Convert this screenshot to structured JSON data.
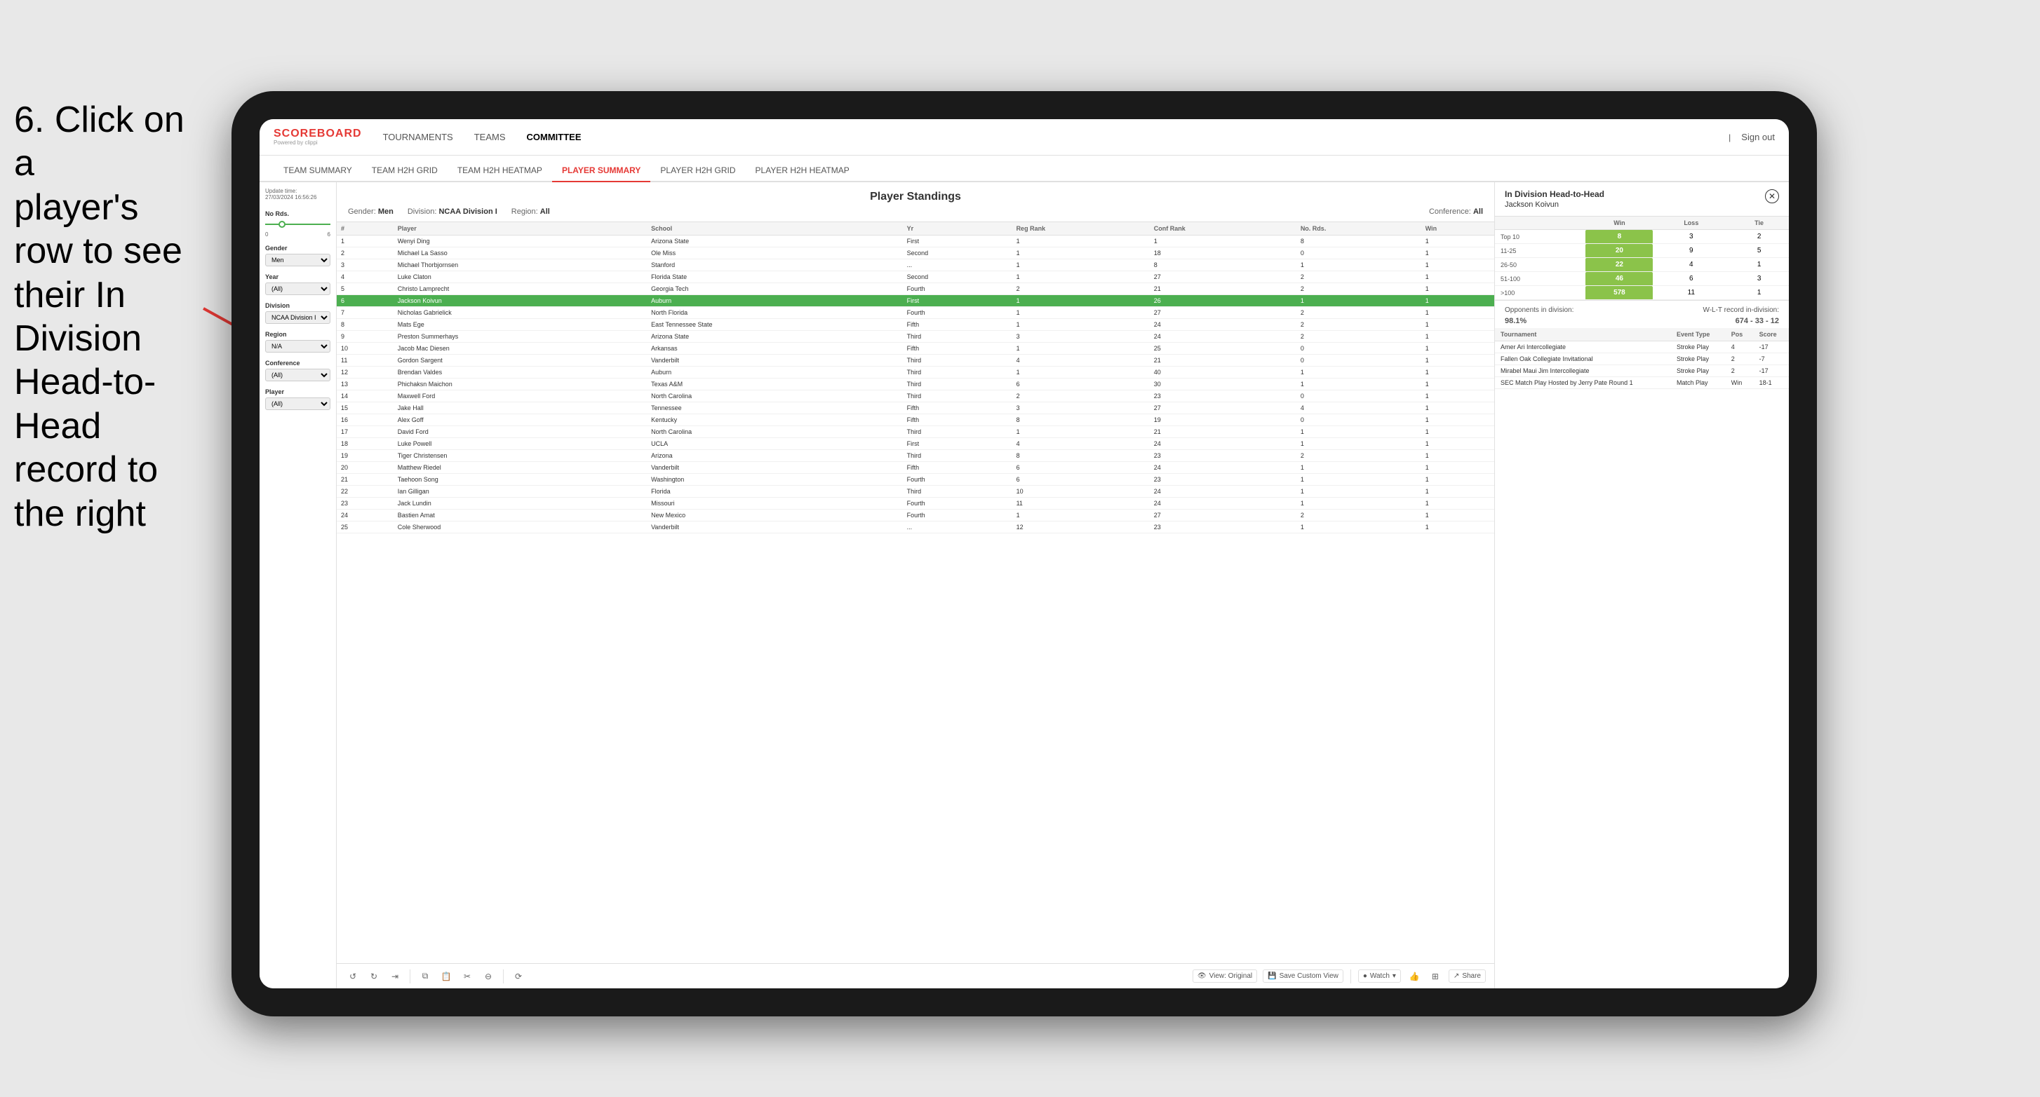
{
  "instruction": {
    "line1": "6. Click on a",
    "line2": "player's row to see",
    "line3": "their In Division",
    "line4": "Head-to-Head",
    "line5": "record to the right"
  },
  "nav": {
    "logo": "SCOREBOARD",
    "logo_sub": "Powered by clippi",
    "items": [
      "TOURNAMENTS",
      "TEAMS",
      "COMMITTEE"
    ],
    "sign_out": "Sign out"
  },
  "sub_nav": {
    "items": [
      "TEAM SUMMARY",
      "TEAM H2H GRID",
      "TEAM H2H HEATMAP",
      "PLAYER SUMMARY",
      "PLAYER H2H GRID",
      "PLAYER H2H HEATMAP"
    ],
    "active": "PLAYER SUMMARY"
  },
  "update_time": {
    "label": "Update time:",
    "value": "27/03/2024 16:56:26"
  },
  "standings": {
    "title": "Player Standings",
    "gender_label": "Gender:",
    "gender": "Men",
    "division_label": "Division:",
    "division": "NCAA Division I",
    "region_label": "Region:",
    "region": "All",
    "conference_label": "Conference:",
    "conference": "All",
    "columns": [
      "#",
      "Player",
      "School",
      "Yr",
      "Reg Rank",
      "Conf Rank",
      "No. Rds.",
      "Win"
    ],
    "rows": [
      {
        "rank": "1",
        "player": "Wenyi Ding",
        "school": "Arizona State",
        "year": "First",
        "reg_rank": "1",
        "conf_rank": "1",
        "no_rds": "8",
        "win": "1"
      },
      {
        "rank": "2",
        "player": "Michael La Sasso",
        "school": "Ole Miss",
        "year": "Second",
        "reg_rank": "1",
        "conf_rank": "18",
        "no_rds": "0",
        "win": "1"
      },
      {
        "rank": "3",
        "player": "Michael Thorbjornsen",
        "school": "Stanford",
        "year": "...",
        "reg_rank": "1",
        "conf_rank": "8",
        "no_rds": "1",
        "win": "1"
      },
      {
        "rank": "4",
        "player": "Luke Claton",
        "school": "Florida State",
        "year": "Second",
        "reg_rank": "1",
        "conf_rank": "27",
        "no_rds": "2",
        "win": "1"
      },
      {
        "rank": "5",
        "player": "Christo Lamprecht",
        "school": "Georgia Tech",
        "year": "Fourth",
        "reg_rank": "2",
        "conf_rank": "21",
        "no_rds": "2",
        "win": "1"
      },
      {
        "rank": "6",
        "player": "Jackson Koivun",
        "school": "Auburn",
        "year": "First",
        "reg_rank": "1",
        "conf_rank": "26",
        "no_rds": "1",
        "win": "1",
        "highlighted": true
      },
      {
        "rank": "7",
        "player": "Nicholas Gabrielick",
        "school": "North Florida",
        "year": "Fourth",
        "reg_rank": "1",
        "conf_rank": "27",
        "no_rds": "2",
        "win": "1"
      },
      {
        "rank": "8",
        "player": "Mats Ege",
        "school": "East Tennessee State",
        "year": "Fifth",
        "reg_rank": "1",
        "conf_rank": "24",
        "no_rds": "2",
        "win": "1"
      },
      {
        "rank": "9",
        "player": "Preston Summerhays",
        "school": "Arizona State",
        "year": "Third",
        "reg_rank": "3",
        "conf_rank": "24",
        "no_rds": "2",
        "win": "1"
      },
      {
        "rank": "10",
        "player": "Jacob Mac Diesen",
        "school": "Arkansas",
        "year": "Fifth",
        "reg_rank": "1",
        "conf_rank": "25",
        "no_rds": "0",
        "win": "1"
      },
      {
        "rank": "11",
        "player": "Gordon Sargent",
        "school": "Vanderbilt",
        "year": "Third",
        "reg_rank": "4",
        "conf_rank": "21",
        "no_rds": "0",
        "win": "1"
      },
      {
        "rank": "12",
        "player": "Brendan Valdes",
        "school": "Auburn",
        "year": "Third",
        "reg_rank": "1",
        "conf_rank": "40",
        "no_rds": "1",
        "win": "1"
      },
      {
        "rank": "13",
        "player": "Phichaksn Maichon",
        "school": "Texas A&M",
        "year": "Third",
        "reg_rank": "6",
        "conf_rank": "30",
        "no_rds": "1",
        "win": "1"
      },
      {
        "rank": "14",
        "player": "Maxwell Ford",
        "school": "North Carolina",
        "year": "Third",
        "reg_rank": "2",
        "conf_rank": "23",
        "no_rds": "0",
        "win": "1"
      },
      {
        "rank": "15",
        "player": "Jake Hall",
        "school": "Tennessee",
        "year": "Fifth",
        "reg_rank": "3",
        "conf_rank": "27",
        "no_rds": "4",
        "win": "1"
      },
      {
        "rank": "16",
        "player": "Alex Goff",
        "school": "Kentucky",
        "year": "Fifth",
        "reg_rank": "8",
        "conf_rank": "19",
        "no_rds": "0",
        "win": "1"
      },
      {
        "rank": "17",
        "player": "David Ford",
        "school": "North Carolina",
        "year": "Third",
        "reg_rank": "1",
        "conf_rank": "21",
        "no_rds": "1",
        "win": "1"
      },
      {
        "rank": "18",
        "player": "Luke Powell",
        "school": "UCLA",
        "year": "First",
        "reg_rank": "4",
        "conf_rank": "24",
        "no_rds": "1",
        "win": "1"
      },
      {
        "rank": "19",
        "player": "Tiger Christensen",
        "school": "Arizona",
        "year": "Third",
        "reg_rank": "8",
        "conf_rank": "23",
        "no_rds": "2",
        "win": "1"
      },
      {
        "rank": "20",
        "player": "Matthew Riedel",
        "school": "Vanderbilt",
        "year": "Fifth",
        "reg_rank": "6",
        "conf_rank": "24",
        "no_rds": "1",
        "win": "1"
      },
      {
        "rank": "21",
        "player": "Taehoon Song",
        "school": "Washington",
        "year": "Fourth",
        "reg_rank": "6",
        "conf_rank": "23",
        "no_rds": "1",
        "win": "1"
      },
      {
        "rank": "22",
        "player": "Ian Gilligan",
        "school": "Florida",
        "year": "Third",
        "reg_rank": "10",
        "conf_rank": "24",
        "no_rds": "1",
        "win": "1"
      },
      {
        "rank": "23",
        "player": "Jack Lundin",
        "school": "Missouri",
        "year": "Fourth",
        "reg_rank": "11",
        "conf_rank": "24",
        "no_rds": "1",
        "win": "1"
      },
      {
        "rank": "24",
        "player": "Bastien Amat",
        "school": "New Mexico",
        "year": "Fourth",
        "reg_rank": "1",
        "conf_rank": "27",
        "no_rds": "2",
        "win": "1"
      },
      {
        "rank": "25",
        "player": "Cole Sherwood",
        "school": "Vanderbilt",
        "year": "...",
        "reg_rank": "12",
        "conf_rank": "23",
        "no_rds": "1",
        "win": "1"
      }
    ]
  },
  "h2h": {
    "title": "In Division Head-to-Head",
    "player": "Jackson Koivun",
    "table_headers": [
      "",
      "Win",
      "Loss",
      "Tie"
    ],
    "rows": [
      {
        "rank_range": "Top 10",
        "win": "8",
        "loss": "3",
        "tie": "2"
      },
      {
        "rank_range": "11-25",
        "win": "20",
        "loss": "9",
        "tie": "5"
      },
      {
        "rank_range": "26-50",
        "win": "22",
        "loss": "4",
        "tie": "1"
      },
      {
        "rank_range": "51-100",
        "win": "46",
        "loss": "6",
        "tie": "3"
      },
      {
        "rank_range": ">100",
        "win": "578",
        "loss": "11",
        "tie": "1"
      }
    ],
    "opponents_label": "Opponents in division:",
    "wl_label": "W-L-T record in-division:",
    "opponents_pct": "98.1%",
    "wl_record": "674 - 33 - 12",
    "tournament_headers": [
      "Tournament",
      "Event Type",
      "Pos",
      "Score"
    ],
    "tournaments": [
      {
        "name": "Amer Ari Intercollegiate",
        "type": "Stroke Play",
        "pos": "4",
        "score": "-17"
      },
      {
        "name": "Fallen Oak Collegiate Invitational",
        "type": "Stroke Play",
        "pos": "2",
        "score": "-7"
      },
      {
        "name": "Mirabel Maui Jim Intercollegiate",
        "type": "Stroke Play",
        "pos": "2",
        "score": "-17"
      },
      {
        "name": "SEC Match Play Hosted by Jerry Pate Round 1",
        "type": "Match Play",
        "pos": "Win",
        "score": "18-1"
      }
    ]
  },
  "filters": {
    "no_rds_label": "No Rds.",
    "no_rds_min": "0",
    "no_rds_max": "6",
    "gender_label": "Gender",
    "gender_value": "Men",
    "year_label": "Year",
    "year_value": "(All)",
    "division_label": "Division",
    "division_value": "NCAA Division I",
    "region_label": "Region",
    "region_value": "N/A",
    "conference_label": "Conference",
    "conference_value": "(All)",
    "player_label": "Player",
    "player_value": "(All)"
  },
  "toolbar": {
    "view_original": "View: Original",
    "save_custom": "Save Custom View",
    "watch": "Watch",
    "share": "Share"
  }
}
